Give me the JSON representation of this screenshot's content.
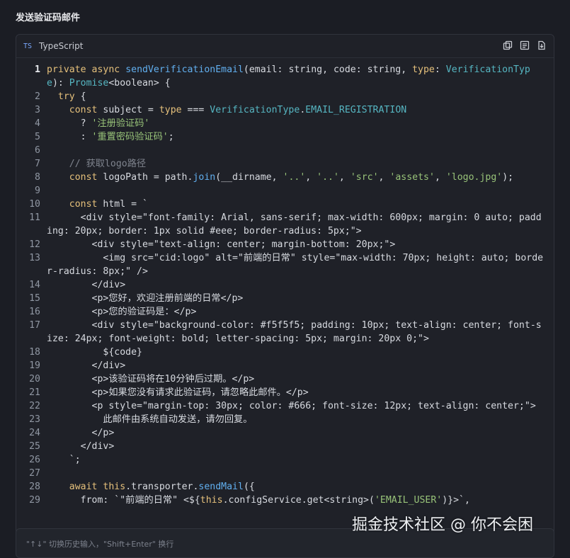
{
  "section_title": "发送验证码邮件",
  "code_block": {
    "language_icon": "TS",
    "language": "TypeScript",
    "actions": [
      "copy-icon",
      "wrap-icon",
      "download-icon"
    ],
    "lines": [
      {
        "n": "1",
        "text": "private async sendVerificationEmail(email: string, code: string, type: VerificationType): Promise<boolean> {"
      },
      {
        "n": "2",
        "text": "  try {"
      },
      {
        "n": "3",
        "text": "    const subject = type === VerificationType.EMAIL_REGISTRATION"
      },
      {
        "n": "4",
        "text": "      ? '注册验证码'"
      },
      {
        "n": "5",
        "text": "      : '重置密码验证码';"
      },
      {
        "n": "6",
        "text": ""
      },
      {
        "n": "7",
        "text": "    // 获取logo路径"
      },
      {
        "n": "8",
        "text": "    const logoPath = path.join(__dirname, '..', '..', 'src', 'assets', 'logo.jpg');"
      },
      {
        "n": "9",
        "text": ""
      },
      {
        "n": "10",
        "text": "    const html = `"
      },
      {
        "n": "11",
        "text": "      <div style=\"font-family: Arial, sans-serif; max-width: 600px; margin: 0 auto; padding: 20px; border: 1px solid #eee; border-radius: 5px;\">"
      },
      {
        "n": "12",
        "text": "        <div style=\"text-align: center; margin-bottom: 20px;\">"
      },
      {
        "n": "13",
        "text": "          <img src=\"cid:logo\" alt=\"前端的日常\" style=\"max-width: 70px; height: auto; border-radius: 8px;\" />"
      },
      {
        "n": "14",
        "text": "        </div>"
      },
      {
        "n": "15",
        "text": "        <p>您好，欢迎注册前端的日常</p>"
      },
      {
        "n": "16",
        "text": "        <p>您的验证码是：</p>"
      },
      {
        "n": "17",
        "text": "        <div style=\"background-color: #f5f5f5; padding: 10px; text-align: center; font-size: 24px; font-weight: bold; letter-spacing: 5px; margin: 20px 0;\">"
      },
      {
        "n": "18",
        "text": "          ${code}"
      },
      {
        "n": "19",
        "text": "        </div>"
      },
      {
        "n": "20",
        "text": "        <p>该验证码将在10分钟后过期。</p>"
      },
      {
        "n": "21",
        "text": "        <p>如果您没有请求此验证码，请忽略此邮件。</p>"
      },
      {
        "n": "22",
        "text": "        <p style=\"margin-top: 30px; color: #666; font-size: 12px; text-align: center;\">"
      },
      {
        "n": "23",
        "text": "          此邮件由系统自动发送，请勿回复。"
      },
      {
        "n": "24",
        "text": "        </p>"
      },
      {
        "n": "25",
        "text": "      </div>"
      },
      {
        "n": "26",
        "text": "    `;"
      },
      {
        "n": "27",
        "text": ""
      },
      {
        "n": "28",
        "text": "    await this.transporter.sendMail({"
      },
      {
        "n": "29",
        "text": "      from: `\"前端的日常\" <${this.configService.get<string>('EMAIL_USER')}>`,"
      }
    ]
  },
  "input": {
    "placeholder": "\"↑↓\" 切换历史输入，\"Shift+Enter\" 换行"
  },
  "watermark": "掘金技术社区 @ 你不会困"
}
